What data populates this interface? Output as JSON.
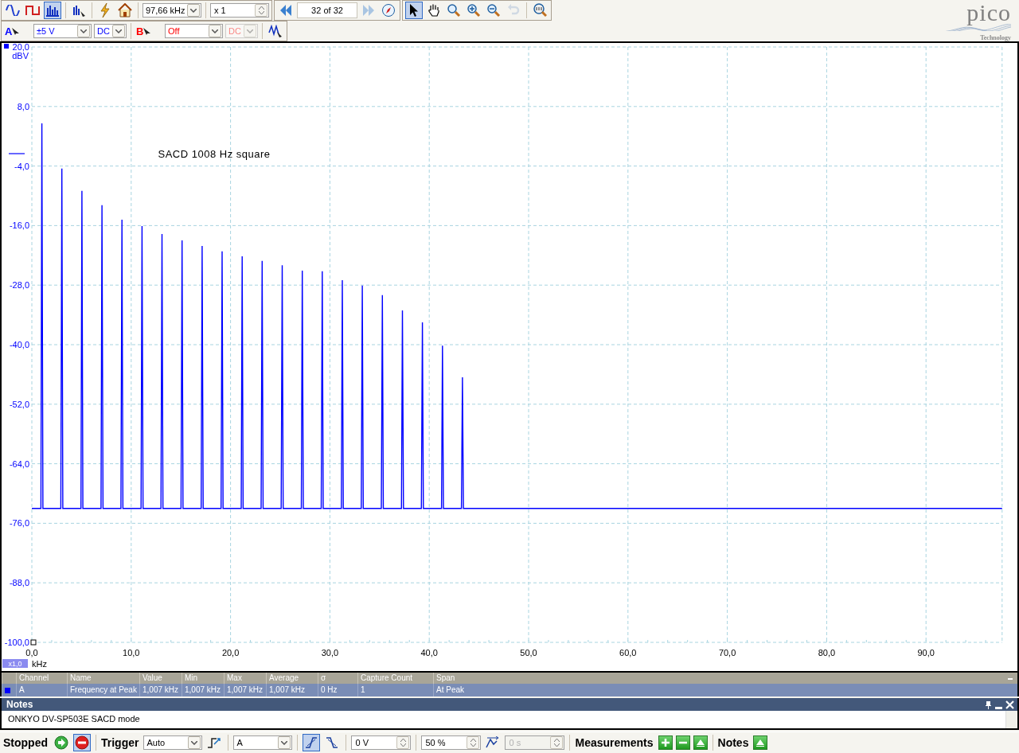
{
  "toolbar": {
    "mode_buttons": [
      {
        "kind": "scope",
        "selected": false
      },
      {
        "kind": "persistence",
        "selected": false
      },
      {
        "kind": "spectrum",
        "selected": true
      }
    ],
    "timebase": "97,66 kHz",
    "zoom": "x 1",
    "capture": "32 of 32",
    "next_disabled": true,
    "tool_buttons": [
      {
        "kind": "pointer",
        "selected": true,
        "disabled": false
      },
      {
        "kind": "hand",
        "selected": false,
        "disabled": false
      },
      {
        "kind": "zoom-area",
        "selected": false,
        "disabled": false
      },
      {
        "kind": "zoom-in",
        "selected": false,
        "disabled": false
      },
      {
        "kind": "zoom-out",
        "selected": false,
        "disabled": false
      },
      {
        "kind": "undo",
        "selected": false,
        "disabled": true
      }
    ]
  },
  "channels": [
    {
      "name": "A",
      "range": "±5 V",
      "coupling": "DC",
      "color": "#0000ff",
      "disabled": false
    },
    {
      "name": "B",
      "range": "Off",
      "coupling": "DC",
      "color": "#ff0000",
      "disabled": true
    }
  ],
  "logo": {
    "wordmark": "pico",
    "tagline": "Technology"
  },
  "chart": {
    "annotation": "SACD 1008 Hz square",
    "x_scale": "x1,0",
    "chart_data": {
      "type": "line",
      "xlabel": "kHz",
      "ylabel": "dBV",
      "xlim": [
        0,
        97.66
      ],
      "ylim": [
        -100,
        20
      ],
      "xticks": [
        {
          "value": 0,
          "label": "0,0"
        },
        {
          "value": 10,
          "label": "10,0"
        },
        {
          "value": 20,
          "label": "20,0"
        },
        {
          "value": 30,
          "label": "30,0"
        },
        {
          "value": 40,
          "label": "40,0"
        },
        {
          "value": 50,
          "label": "50,0"
        },
        {
          "value": 60,
          "label": "60,0"
        },
        {
          "value": 70,
          "label": "70,0"
        },
        {
          "value": 80,
          "label": "80,0"
        },
        {
          "value": 90,
          "label": "90,0"
        }
      ],
      "yticks": [
        {
          "value": 20,
          "label": "20,0"
        },
        {
          "value": 8,
          "label": "8,0"
        },
        {
          "value": -4,
          "label": "-4,0"
        },
        {
          "value": -16,
          "label": "-16,0"
        },
        {
          "value": -28,
          "label": "-28,0"
        },
        {
          "value": -40,
          "label": "-40,0"
        },
        {
          "value": -52,
          "label": "-52,0"
        },
        {
          "value": -64,
          "label": "-64,0"
        },
        {
          "value": -76,
          "label": "-76,0"
        },
        {
          "value": -88,
          "label": "-88,0"
        },
        {
          "value": -100,
          "label": "-100,0"
        }
      ],
      "x": [
        0,
        0.91,
        1.01,
        1.11,
        2.92,
        3.02,
        3.12,
        4.94,
        5.04,
        5.14,
        6.96,
        7.06,
        7.16,
        8.97,
        9.07,
        9.17,
        10.99,
        11.09,
        11.19,
        13.0,
        13.1,
        13.2,
        15.02,
        15.12,
        15.22,
        17.04,
        17.14,
        17.24,
        19.05,
        19.15,
        19.25,
        21.07,
        21.17,
        21.27,
        23.08,
        23.18,
        23.28,
        25.1,
        25.2,
        25.3,
        27.12,
        27.22,
        27.32,
        29.13,
        29.23,
        29.33,
        31.15,
        31.25,
        31.35,
        33.16,
        33.26,
        33.36,
        35.18,
        35.28,
        35.38,
        37.2,
        37.3,
        37.4,
        39.21,
        39.31,
        39.41,
        41.23,
        41.33,
        41.43,
        43.24,
        43.34,
        43.44,
        97.66
      ],
      "grid": true,
      "series": [
        {
          "color": "#0000ff",
          "values": [
            -73,
            -73,
            4.6,
            -73,
            -73,
            -4.5,
            -73,
            -73,
            -9.0,
            -73,
            -73,
            -11.9,
            -73,
            -73,
            -14.8,
            -73,
            -73,
            -16.1,
            -73,
            -73,
            -17.7,
            -73,
            -73,
            -19.0,
            -73,
            -73,
            -20.1,
            -73,
            -73,
            -21.2,
            -73,
            -73,
            -22.2,
            -73,
            -73,
            -23.1,
            -73,
            -73,
            -24.0,
            -73,
            -73,
            -25.1,
            -73,
            -73,
            -25.2,
            -73,
            -73,
            -27.0,
            -73,
            -73,
            -28.1,
            -73,
            -73,
            -30.0,
            -73,
            -73,
            -33.1,
            -73,
            -73,
            -35.5,
            -73,
            -73,
            -40.2,
            -73,
            -73,
            -46.6,
            -73,
            -73
          ]
        }
      ]
    }
  },
  "measurements": {
    "columns": [
      "Channel",
      "Name",
      "Value",
      "Min",
      "Max",
      "Average",
      "σ",
      "Capture Count",
      "Span"
    ],
    "rows": [
      {
        "selected": true,
        "color": "#0000ff",
        "cells": [
          "A",
          "Frequency at Peak",
          "1,007 kHz",
          "1,007 kHz",
          "1,007 kHz",
          "1,007 kHz",
          "0 Hz",
          "1",
          "At Peak"
        ]
      }
    ]
  },
  "notes": {
    "title": "Notes",
    "text": "ONKYO DV-SP503E SACD mode"
  },
  "bottom_bar": {
    "status": "Stopped",
    "run_buttons": [
      {
        "kind": "start",
        "selected": false
      },
      {
        "kind": "stop",
        "selected": true
      }
    ],
    "trigger_label": "Trigger",
    "trigger_mode": "Auto",
    "trigger_source": "A",
    "edges": [
      {
        "kind": "rising",
        "selected": true
      },
      {
        "kind": "falling",
        "selected": false
      }
    ],
    "threshold": "0 V",
    "pre_trigger": "50 %",
    "delay": {
      "value": "0 s",
      "disabled": true
    },
    "measurements_label": "Measurements",
    "notes_label": "Notes"
  }
}
